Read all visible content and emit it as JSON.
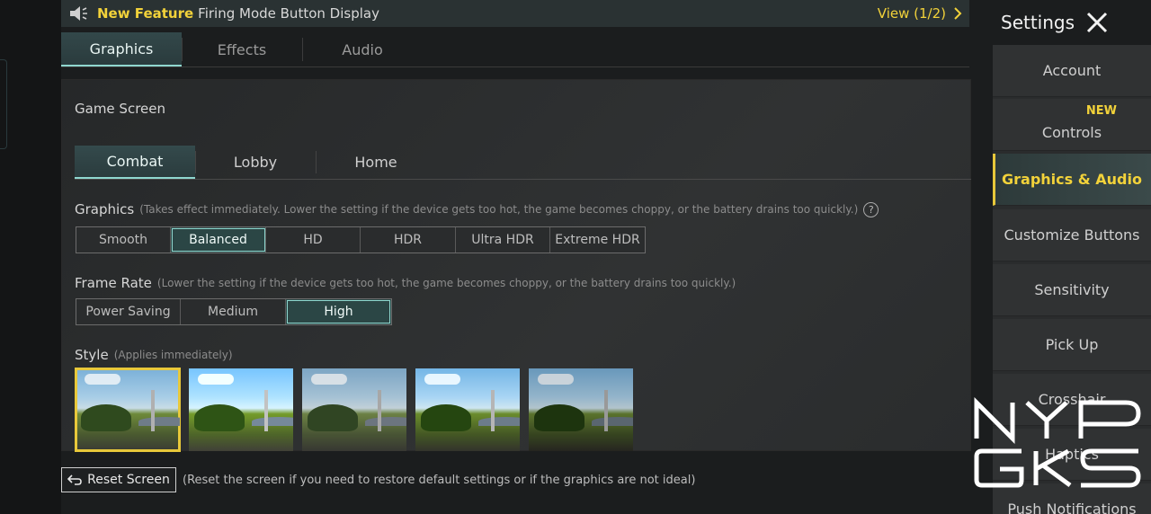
{
  "banner": {
    "new_label": "New Feature",
    "feature_text": "Firing Mode Button Display",
    "view_label": "View (1/2)"
  },
  "top_tabs": [
    {
      "label": "Graphics",
      "active": true
    },
    {
      "label": "Effects",
      "active": false
    },
    {
      "label": "Audio",
      "active": false
    }
  ],
  "section_title": "Game Screen",
  "sub_tabs": [
    {
      "label": "Combat",
      "active": true
    },
    {
      "label": "Lobby",
      "active": false
    },
    {
      "label": "Home",
      "active": false
    }
  ],
  "graphics": {
    "label": "Graphics",
    "hint": "(Takes effect immediately. Lower the setting if the device gets too hot, the game becomes choppy, or the battery drains too quickly.)",
    "help_icon": "?",
    "options": [
      "Smooth",
      "Balanced",
      "HD",
      "HDR",
      "Ultra HDR",
      "Extreme HDR"
    ],
    "selected": "Balanced"
  },
  "frame_rate": {
    "label": "Frame Rate",
    "hint": "(Lower the setting if the device gets too hot, the game becomes choppy, or the battery drains too quickly.)",
    "options": [
      "Power Saving",
      "Medium",
      "High"
    ],
    "selected": "High"
  },
  "style": {
    "label": "Style",
    "hint": "(Applies immediately)",
    "selected_index": 0
  },
  "reset": {
    "button_label": "Reset Screen",
    "hint": "(Reset the screen if you need to restore default settings or if the graphics are not ideal)"
  },
  "settings": {
    "title": "Settings",
    "items": [
      {
        "label": "Account",
        "active": false
      },
      {
        "label": "Controls",
        "active": false,
        "tag": "NEW"
      },
      {
        "label": "Graphics & Audio",
        "active": true
      },
      {
        "label": "Customize Buttons",
        "active": false
      },
      {
        "label": "Sensitivity",
        "active": false
      },
      {
        "label": "Pick Up",
        "active": false
      },
      {
        "label": "Crosshair",
        "active": false
      },
      {
        "label": "Haptics",
        "active": false
      },
      {
        "label": "Push Notifications",
        "active": false
      }
    ]
  },
  "watermark": "NYP GKS",
  "colors": {
    "accent_teal": "#8fd7cf",
    "accent_yellow": "#f2d23a"
  }
}
